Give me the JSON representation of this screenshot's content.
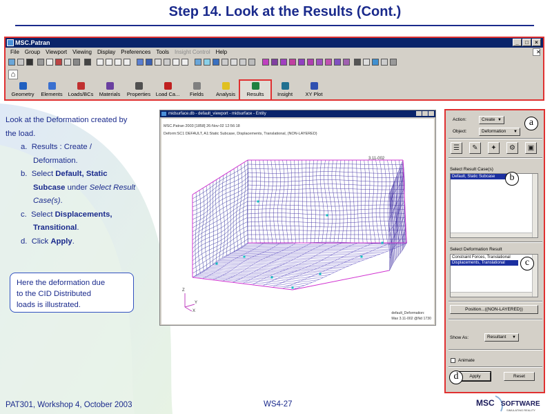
{
  "slide": {
    "title": "Step 14.  Look at the Results (Cont.)",
    "footer_left": "PAT301, Workshop 4, October 2003",
    "footer_center": "WS4-27",
    "logo_text": "MSC SOFTWARE",
    "logo_tagline": "SIMULATING REALITY"
  },
  "instructions": {
    "intro_line1": "Look at the Deformation created by",
    "intro_line2": "the load.",
    "steps": [
      {
        "marker": "a.",
        "parts": [
          "Results : Create /",
          "Deformation."
        ]
      },
      {
        "marker": "b.",
        "parts": [
          "Select ",
          "Default, Static",
          "Subcase",
          " under ",
          "Select Result",
          "Case(s)",
          "."
        ]
      },
      {
        "marker": "c.",
        "parts": [
          "Select ",
          "Displacements,",
          "Transitional",
          "."
        ]
      },
      {
        "marker": "d.",
        "parts": [
          "Click ",
          "Apply",
          "."
        ]
      }
    ],
    "callout": [
      "Here the deformation due",
      "to the CID Distributed",
      "loads is illustrated."
    ]
  },
  "patran": {
    "title": "MSC.Patran",
    "window_buttons": [
      "_",
      "□",
      "×"
    ],
    "menu": [
      {
        "label": "File",
        "disabled": false
      },
      {
        "label": "Group",
        "disabled": false
      },
      {
        "label": "Viewport",
        "disabled": false
      },
      {
        "label": "Viewing",
        "disabled": false
      },
      {
        "label": "Display",
        "disabled": false
      },
      {
        "label": "Preferences",
        "disabled": false
      },
      {
        "label": "Tools",
        "disabled": false
      },
      {
        "label": "Insight Control",
        "disabled": true
      },
      {
        "label": "Help",
        "disabled": false
      }
    ],
    "home_icon": "⌂",
    "applications": [
      {
        "label": "Geometry",
        "icon": "geometry-icon",
        "color": "#2060c0"
      },
      {
        "label": "Elements",
        "icon": "elements-icon",
        "color": "#3a70d0"
      },
      {
        "label": "Loads/BCs",
        "icon": "loads-icon",
        "color": "#c03030"
      },
      {
        "label": "Materials",
        "icon": "materials-icon",
        "color": "#6a40a0"
      },
      {
        "label": "Properties",
        "icon": "properties-icon",
        "color": "#505050"
      },
      {
        "label": "Load Ca...",
        "icon": "load-cases-icon",
        "color": "#c02020"
      },
      {
        "label": "Fields",
        "icon": "fields-icon",
        "color": "#808080"
      },
      {
        "label": "Analysis",
        "icon": "analysis-icon",
        "color": "#e0c020"
      },
      {
        "label": "Results",
        "icon": "results-icon",
        "color": "#208040",
        "active": true
      },
      {
        "label": "Insight",
        "icon": "insight-icon",
        "color": "#207090"
      },
      {
        "label": "XY Plot",
        "icon": "xy-plot-icon",
        "color": "#3050b0"
      }
    ]
  },
  "viewport": {
    "title": "midsurface.db - default_viewport - midsurface - Entity",
    "header_line1": "MSC.Patran 2003 [1858] 26-Nov-02 12:56:18",
    "header_line2": "Deform:SC1 DEFAULT, A1:Static Subcase, Displacements, Translational, (NON-LAYERED)",
    "max_tag": "3.11-002",
    "footer_line1": "default_Deformation:",
    "footer_line2": "Max 3.11-002 @Nd 1730",
    "axis_z": "Z",
    "axis_y": "Y",
    "axis_x": "X"
  },
  "results_form": {
    "action_label": "Action:",
    "action_value": "Create",
    "object_label": "Object:",
    "object_value": "Deformation",
    "tool_icons": [
      "☰",
      "✎",
      "✦",
      "⚙",
      "▣"
    ],
    "result_cases_label": "Select Result Case(s)",
    "result_cases": [
      {
        "label": "Default, Static Subcase",
        "selected": true
      }
    ],
    "deformation_label": "Select Deformation Result",
    "deformation_results": [
      {
        "label": "Constraint Forces, Translational",
        "selected": false
      },
      {
        "label": "Displacements, Translational",
        "selected": true
      }
    ],
    "position_button": "Position...((NON-LAYERED))",
    "show_as_label": "Show As:",
    "show_as_value": "Resultant",
    "animate_label": "Animate",
    "animate_checked": false,
    "apply_button": "Apply",
    "reset_button": "Reset",
    "badges": [
      "a",
      "b",
      "c",
      "d"
    ]
  },
  "colors": {
    "title_blue": "#1a2a8c",
    "highlight_red": "#e03030",
    "selection_blue": "#1b2fa0",
    "panel_gray": "#d4d0c8"
  }
}
